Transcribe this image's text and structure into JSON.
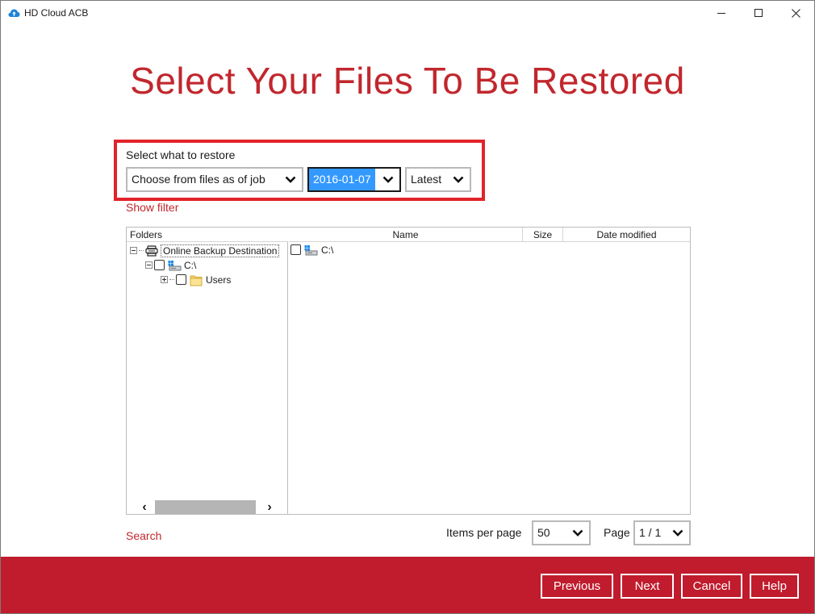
{
  "window": {
    "title": "HD Cloud ACB",
    "icon": "cloud-upload-icon"
  },
  "page": {
    "title": "Select Your Files To Be Restored"
  },
  "restore": {
    "label": "Select what to restore",
    "mode": "Choose from files as of job",
    "date": "2016-01-07",
    "version": "Latest"
  },
  "links": {
    "show_filter": "Show filter",
    "search": "Search"
  },
  "folders": {
    "header": "Folders",
    "tree": [
      {
        "label": "Online Backup Destination",
        "icon": "backup-destination-icon"
      },
      {
        "label": "C:\\",
        "icon": "drive-icon"
      },
      {
        "label": "Users",
        "icon": "folder-icon"
      }
    ]
  },
  "files": {
    "columns": {
      "name": "Name",
      "size": "Size",
      "date": "Date modified"
    },
    "rows": [
      {
        "name": "C:\\",
        "icon": "drive-icon"
      }
    ]
  },
  "pagination": {
    "items_per_page_label": "Items per page",
    "items_per_page": "50",
    "page_label": "Page",
    "page": "1 / 1"
  },
  "footer": {
    "previous": "Previous",
    "next": "Next",
    "cancel": "Cancel",
    "help": "Help"
  },
  "colors": {
    "accent": "#c1272d",
    "footer": "#c01c2d",
    "highlight_box": "#e2232a",
    "selection": "#3399ff"
  }
}
